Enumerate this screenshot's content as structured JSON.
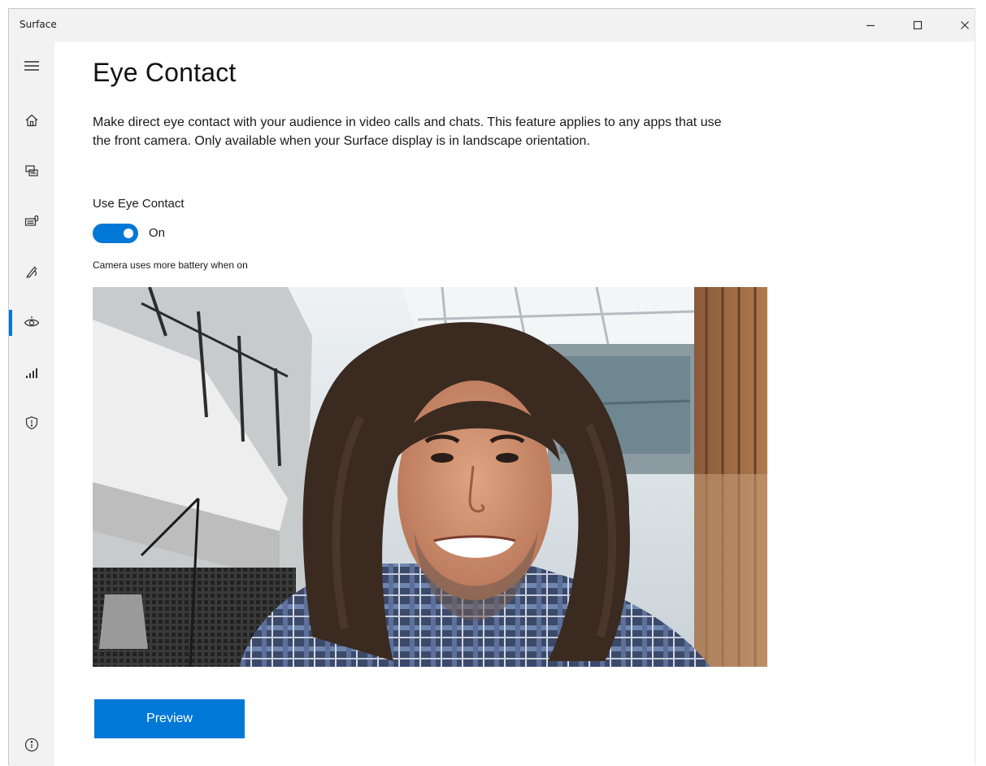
{
  "window": {
    "app_title": "Surface",
    "controls": {
      "minimize_icon": "minimize-icon",
      "maximize_icon": "maximize-icon",
      "close_icon": "close-icon"
    }
  },
  "sidebar": {
    "menu_icon": "hamburger-menu-icon",
    "items": [
      {
        "name": "home",
        "icon": "home-icon",
        "selected": false
      },
      {
        "name": "devices",
        "icon": "devices-icon",
        "selected": false
      },
      {
        "name": "keyboard-accessories",
        "icon": "keyboard-icon",
        "selected": false
      },
      {
        "name": "pen",
        "icon": "pen-icon",
        "selected": false
      },
      {
        "name": "eye-contact",
        "icon": "eye-contact-icon",
        "selected": true
      },
      {
        "name": "performance",
        "icon": "signal-bars-icon",
        "selected": false
      },
      {
        "name": "security",
        "icon": "shield-icon",
        "selected": false
      }
    ],
    "bottom_icon": "info-icon"
  },
  "main": {
    "title": "Eye Contact",
    "description": "Make direct eye contact with your audience in video calls and chats. This feature applies to any apps that use the front camera. Only available when your Surface display is in landscape orientation.",
    "setting": {
      "label": "Use Eye Contact",
      "state": "On",
      "enabled": true,
      "helper": "Camera uses more battery when on"
    },
    "preview_button": "Preview"
  },
  "colors": {
    "accent": "#0078d7",
    "chrome": "#f2f2f2"
  }
}
